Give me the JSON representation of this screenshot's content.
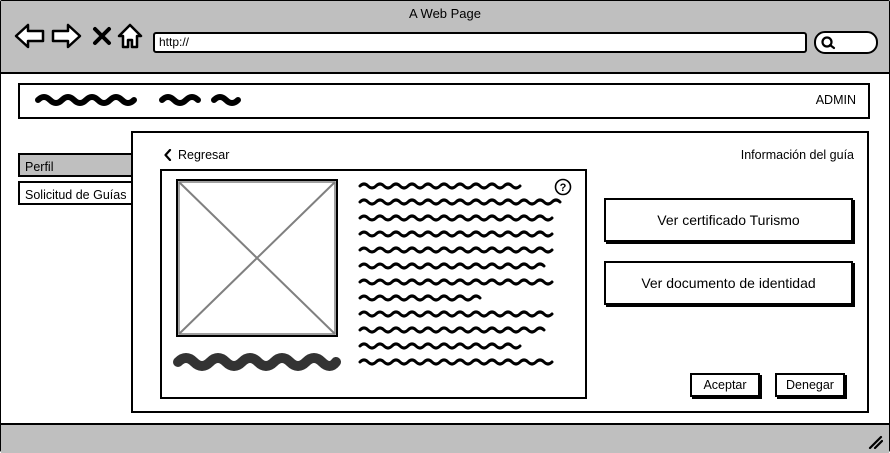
{
  "window": {
    "title": "A Web Page",
    "url": "http://"
  },
  "header": {
    "user_label": "ADMIN"
  },
  "sidebar": {
    "items": [
      {
        "label": "Perfil"
      },
      {
        "label": "Solicitud de Guías"
      }
    ]
  },
  "panel": {
    "back_label": "Regresar",
    "title": "Información del guía",
    "buttons": {
      "certificate": "Ver certificado Turismo",
      "identity": "Ver documento de identidad",
      "accept": "Aceptar",
      "deny": "Denegar"
    }
  },
  "icons": [
    "back-arrow-icon",
    "forward-arrow-icon",
    "close-icon",
    "home-icon",
    "search-icon",
    "chevron-left-icon",
    "help-icon",
    "image-placeholder-icon",
    "resize-grip-icon"
  ]
}
